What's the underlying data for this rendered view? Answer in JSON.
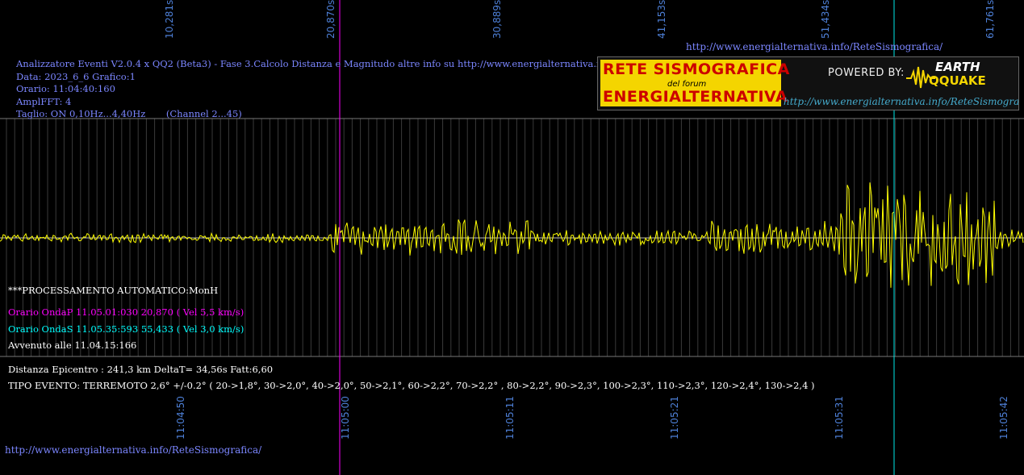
{
  "header": {
    "url_top": "http://www.energialternativa.info/ReteSismografica/",
    "lines": [
      "Analizzatore Eventi V2.0.4 x QQ2 (Beta3) - Fase 3.Calcolo Distanza e Magnitudo altre info su http://www.energialternativa.info/ReteSism",
      "Data: 2023_6_6 Grafico:1",
      "Orario: 11:04:40:160",
      "AmplFFT: 4",
      "Taglio: ON 0,10Hz...4,40Hz       (Channel 2...45)"
    ]
  },
  "logo": {
    "line1": "RETE SISMOGRAFICA",
    "line2": "del forum",
    "line3": "ENERGIALTERNATIVA",
    "powered": "POWERED BY:",
    "brand1": "EARTH",
    "brand2": "QQUAKE",
    "url": "http://www.energialternativa.info/ReteSismografica"
  },
  "top_axis_labels": [
    "10,281s",
    "20,870s",
    "30,889s",
    "41,153s",
    "51,434s",
    "61,761s"
  ],
  "bottom_axis_labels": [
    "11:04:50",
    "11:05:00",
    "11:05:11",
    "11:05:21",
    "11:05:31",
    "11:05:42"
  ],
  "processing": {
    "title": "***PROCESSAMENTO AUTOMATICO:MonH",
    "p_wave": "Orario OndaP 11.05.01:030  20,870 ( Vel 5,5 km/s)",
    "s_wave": "Orario OndaS 11.05.35:593  55,433 ( Vel 3,0 km/s)",
    "occurred": "Avvenuto alle 11.04.15:166"
  },
  "result": {
    "distance": "Distanza Epicentro : 241,3 km DeltaT= 34,56s  Fatt:6,60",
    "event_type": "TIPO EVENTO: TERREMOTO 2,6° +/-0.2° ( 20->1,8°, 30->2,0°, 40->2,0°, 50->2,1°, 60->2,2°, 70->2,2° , 80->2,2°, 90->2,3°, 100->2,3°, 110->2,3°, 120->2,4°, 130->2,4 )"
  },
  "footer_url": "http://www.energialternativa.info/ReteSismografica/",
  "colors": {
    "background": "#000000",
    "trace": "#ffff00",
    "p_wave": "#ff00ff",
    "s_wave": "#00ffff",
    "axis_text": "#4d7fd6",
    "info_text": "#7b86ff",
    "grid": "#888888"
  }
}
